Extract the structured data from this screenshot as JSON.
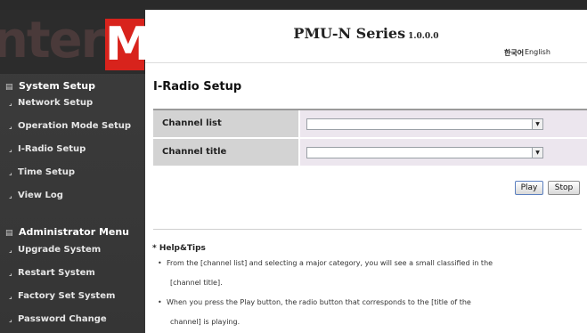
{
  "logo": {
    "text": "interM",
    "prefix": "nter",
    "accent": "M",
    "accent_color": "#d8231c"
  },
  "header": {
    "title": "PMU-N Series",
    "version": "1.0.0.0",
    "lang_korean": "한국어",
    "lang_english": "English"
  },
  "sidebar": {
    "sections": [
      {
        "title": "System Setup",
        "items": [
          "Network Setup",
          "Operation Mode Setup",
          "I-Radio Setup",
          "Time Setup",
          "View Log"
        ]
      },
      {
        "title": "Administrator Menu",
        "items": [
          "Upgrade System",
          "Restart System",
          "Factory Set System",
          "Password Change"
        ]
      }
    ]
  },
  "page": {
    "title": "I-Radio Setup",
    "fields": [
      {
        "label": "Channel list",
        "value": ""
      },
      {
        "label": "Channel title",
        "value": ""
      }
    ],
    "play_label": "Play",
    "stop_label": "Stop"
  },
  "help": {
    "title": "* Help&Tips",
    "tips": [
      {
        "line1": "From the [channel list] and selecting a major category, you will see a small classified in the",
        "line2": "[channel title]."
      },
      {
        "line1": "When you press the Play button, the radio button that corresponds to the [title of the",
        "line2": "channel] is playing."
      }
    ]
  },
  "colors": {
    "sidebar_bg": "#3a3a3a",
    "label_bg": "#d3d3d3",
    "value_bg": "#ece6ee"
  }
}
